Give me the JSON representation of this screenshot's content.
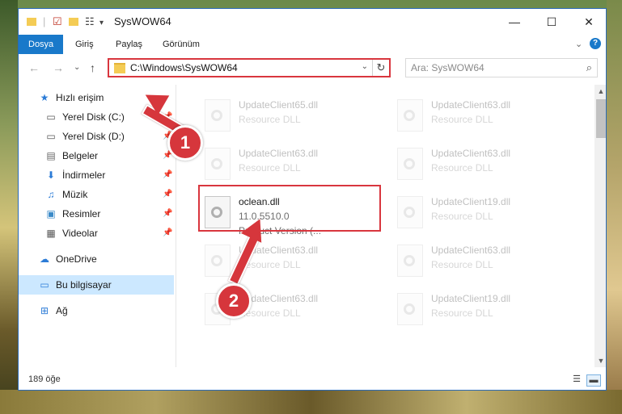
{
  "window": {
    "title": "SysWOW64",
    "controls": {
      "minimize": "—",
      "maximize": "☐",
      "close": "✕"
    }
  },
  "ribbon": {
    "tabs": [
      "Dosya",
      "Giriş",
      "Paylaş",
      "Görünüm"
    ],
    "active_tab": "Dosya"
  },
  "address": {
    "path": "C:\\Windows\\SysWOW64",
    "search_placeholder": "Ara: SysWOW64"
  },
  "nav": {
    "quick_access": "Hızlı erişim",
    "items": [
      {
        "label": "Yerel Disk (C:)",
        "icon": "drive-icon",
        "pinned": true
      },
      {
        "label": "Yerel Disk (D:)",
        "icon": "drive-icon",
        "pinned": true
      },
      {
        "label": "Belgeler",
        "icon": "documents-icon",
        "pinned": true
      },
      {
        "label": "İndirmeler",
        "icon": "downloads-icon",
        "pinned": true
      },
      {
        "label": "Müzik",
        "icon": "music-icon",
        "pinned": true
      },
      {
        "label": "Resimler",
        "icon": "pictures-icon",
        "pinned": true
      },
      {
        "label": "Videolar",
        "icon": "videos-icon",
        "pinned": true
      }
    ],
    "onedrive": "OneDrive",
    "this_pc": "Bu bilgisayar",
    "network": "Ağ"
  },
  "files": [
    {
      "name": "UpdateClient65.dll",
      "desc": "Resource DLL"
    },
    {
      "name": "UpdateClient63.dll",
      "desc": "Resource DLL"
    },
    {
      "name": "UpdateClient63.dll",
      "desc": "Resource DLL"
    },
    {
      "name": "UpdateClient63.dll",
      "desc": "Resource DLL"
    },
    {
      "name": "UpdateClient19.dll",
      "desc": "Resource DLL"
    },
    {
      "name": "UpdateClient63.dll",
      "desc": "Resource DLL"
    },
    {
      "name": "UpdateClient63.dll",
      "desc": "Resource DLL"
    },
    {
      "name": "UpdateClient63.dll",
      "desc": "Resource DLL"
    },
    {
      "name": "UpdateClient19.dll",
      "desc": "Resource DLL"
    }
  ],
  "highlighted_file": {
    "name": "oclean.dll",
    "version": "11.0.5510.0",
    "product": "Product Version    (..."
  },
  "status": {
    "count": "189 öğe"
  },
  "annotations": {
    "step1": "1",
    "step2": "2"
  },
  "colors": {
    "accent": "#1979ca",
    "highlight": "#d9363e",
    "selected": "#cce8ff"
  }
}
